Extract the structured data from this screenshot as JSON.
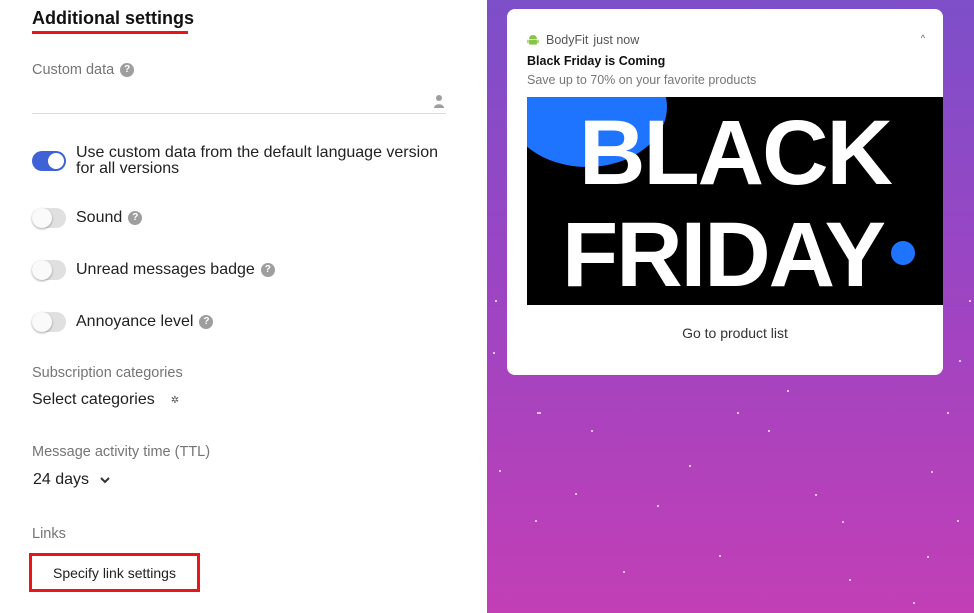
{
  "settings": {
    "title": "Additional settings",
    "custom_data": {
      "label": "Custom data",
      "value": ""
    },
    "toggles": [
      {
        "line1": "Use custom data from the default language version",
        "line2": "for all versions",
        "on": true
      },
      {
        "label": "Sound",
        "on": false
      },
      {
        "label": "Unread messages badge",
        "on": false
      },
      {
        "label": "Annoyance level",
        "on": false
      }
    ],
    "subscription": {
      "label": "Subscription categories",
      "value": "Select categories"
    },
    "ttl": {
      "label": "Message activity time (TTL)",
      "value": "24 days"
    },
    "links": {
      "label": "Links",
      "button": "Specify link settings"
    },
    "accent_color": "#3f63d7",
    "highlight_color": "#e8151b"
  },
  "preview": {
    "app_name": "BodyFit",
    "time": "just now",
    "title": "Black Friday is Coming",
    "body": "Save up to 70% on your favorite products",
    "banner_line1": "BLACK",
    "banner_line2": "FRIDAY",
    "action": "Go to product list",
    "icons": [
      "android-icon",
      "collapse-icon"
    ]
  }
}
